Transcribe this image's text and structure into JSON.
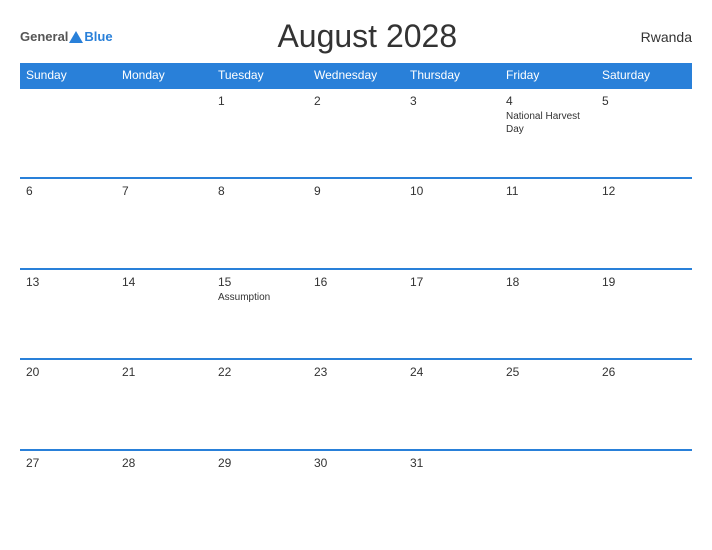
{
  "logo": {
    "general": "General",
    "blue": "Blue"
  },
  "title": "August 2028",
  "country": "Rwanda",
  "weekdays": [
    "Sunday",
    "Monday",
    "Tuesday",
    "Wednesday",
    "Thursday",
    "Friday",
    "Saturday"
  ],
  "weeks": [
    [
      {
        "num": "",
        "empty": true
      },
      {
        "num": "",
        "empty": true
      },
      {
        "num": "1",
        "holiday": ""
      },
      {
        "num": "2",
        "holiday": ""
      },
      {
        "num": "3",
        "holiday": ""
      },
      {
        "num": "4",
        "holiday": "National Harvest Day"
      },
      {
        "num": "5",
        "holiday": ""
      }
    ],
    [
      {
        "num": "6",
        "holiday": ""
      },
      {
        "num": "7",
        "holiday": ""
      },
      {
        "num": "8",
        "holiday": ""
      },
      {
        "num": "9",
        "holiday": ""
      },
      {
        "num": "10",
        "holiday": ""
      },
      {
        "num": "11",
        "holiday": ""
      },
      {
        "num": "12",
        "holiday": ""
      }
    ],
    [
      {
        "num": "13",
        "holiday": ""
      },
      {
        "num": "14",
        "holiday": ""
      },
      {
        "num": "15",
        "holiday": "Assumption"
      },
      {
        "num": "16",
        "holiday": ""
      },
      {
        "num": "17",
        "holiday": ""
      },
      {
        "num": "18",
        "holiday": ""
      },
      {
        "num": "19",
        "holiday": ""
      }
    ],
    [
      {
        "num": "20",
        "holiday": ""
      },
      {
        "num": "21",
        "holiday": ""
      },
      {
        "num": "22",
        "holiday": ""
      },
      {
        "num": "23",
        "holiday": ""
      },
      {
        "num": "24",
        "holiday": ""
      },
      {
        "num": "25",
        "holiday": ""
      },
      {
        "num": "26",
        "holiday": ""
      }
    ],
    [
      {
        "num": "27",
        "holiday": ""
      },
      {
        "num": "28",
        "holiday": ""
      },
      {
        "num": "29",
        "holiday": ""
      },
      {
        "num": "30",
        "holiday": ""
      },
      {
        "num": "31",
        "holiday": ""
      },
      {
        "num": "",
        "empty": true
      },
      {
        "num": "",
        "empty": true
      }
    ]
  ]
}
